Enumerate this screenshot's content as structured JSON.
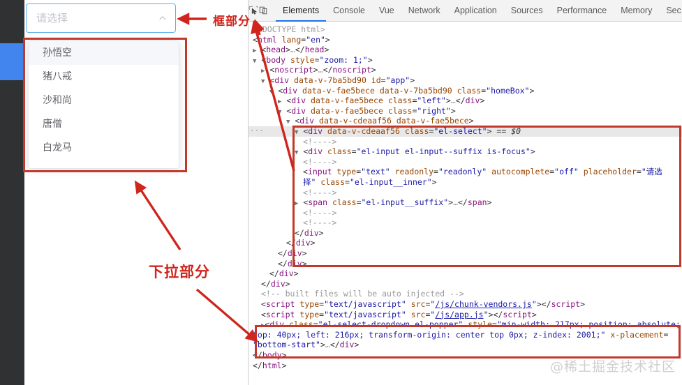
{
  "page": {
    "select": {
      "placeholder": "请选择",
      "arrow_icon": "chevron-up-icon"
    },
    "dropdown": {
      "items": [
        {
          "label": "孙悟空",
          "hovered": true
        },
        {
          "label": "猪八戒",
          "hovered": false
        },
        {
          "label": "沙和尚",
          "hovered": false
        },
        {
          "label": "唐僧",
          "hovered": false
        },
        {
          "label": "白龙马",
          "hovered": false
        }
      ]
    }
  },
  "annotations": {
    "box_label": "框部分",
    "dropdown_label": "下拉部分",
    "accent_color": "#d0251d"
  },
  "devtools": {
    "icons": [
      "inspect-element-icon",
      "device-toolbar-icon"
    ],
    "tabs": [
      {
        "label": "Elements",
        "active": true
      },
      {
        "label": "Console",
        "active": false
      },
      {
        "label": "Vue",
        "active": false
      },
      {
        "label": "Network",
        "active": false
      },
      {
        "label": "Application",
        "active": false
      },
      {
        "label": "Sources",
        "active": false
      },
      {
        "label": "Performance",
        "active": false
      },
      {
        "label": "Memory",
        "active": false
      },
      {
        "label": "Sec",
        "active": false
      }
    ],
    "code_lines": [
      {
        "indent": 0,
        "html": "<span class=\"doctype\">&lt;!DOCTYPE html&gt;</span>"
      },
      {
        "indent": 0,
        "html": "<span class=\"punc\">&lt;</span><span class=\"tag\">html</span> <span class=\"attr\">lang</span><span class=\"punc\">=</span><span class=\"val\">\"en\"</span><span class=\"punc\">&gt;</span>"
      },
      {
        "indent": 0,
        "html": "<span class=\"tri\">&#9654;</span> <span class=\"punc\">&lt;</span><span class=\"tag\">head</span><span class=\"punc\">&gt;</span><span class=\"cmt\">…</span><span class=\"punc\">&lt;/</span><span class=\"tag\">head</span><span class=\"punc\">&gt;</span>"
      },
      {
        "indent": 0,
        "html": "<span class=\"tri\">&#9660;</span> <span class=\"punc\">&lt;</span><span class=\"tag\">body</span> <span class=\"attr\">style</span><span class=\"punc\">=</span><span class=\"val\">\"zoom: 1;\"</span><span class=\"punc\">&gt;</span>"
      },
      {
        "indent": 1,
        "html": "<span class=\"tri\">&#9654;</span> <span class=\"punc\">&lt;</span><span class=\"tag\">noscript</span><span class=\"punc\">&gt;</span><span class=\"cmt\">…</span><span class=\"punc\">&lt;/</span><span class=\"tag\">noscript</span><span class=\"punc\">&gt;</span>"
      },
      {
        "indent": 1,
        "html": "<span class=\"tri\">&#9660;</span> <span class=\"punc\">&lt;</span><span class=\"tag\">div</span> <span class=\"attr\">data-v-7ba5bd90</span> <span class=\"attr\">id</span><span class=\"punc\">=</span><span class=\"val\">\"app\"</span><span class=\"punc\">&gt;</span>"
      },
      {
        "indent": 2,
        "html": "<span class=\"tri\">&#9660;</span> <span class=\"punc\">&lt;</span><span class=\"tag\">div</span> <span class=\"attr\">data-v-fae5bece</span> <span class=\"attr\">data-v-7ba5bd90</span> <span class=\"attr\">class</span><span class=\"punc\">=</span><span class=\"val\">\"homeBox\"</span><span class=\"punc\">&gt;</span>"
      },
      {
        "indent": 3,
        "html": "<span class=\"tri\">&#9654;</span> <span class=\"punc\">&lt;</span><span class=\"tag\">div</span> <span class=\"attr\">data-v-fae5bece</span> <span class=\"attr\">class</span><span class=\"punc\">=</span><span class=\"val\">\"left\"</span><span class=\"punc\">&gt;</span><span class=\"cmt\">…</span><span class=\"punc\">&lt;/</span><span class=\"tag\">div</span><span class=\"punc\">&gt;</span>"
      },
      {
        "indent": 3,
        "html": "<span class=\"tri\">&#9660;</span> <span class=\"punc\">&lt;</span><span class=\"tag\">div</span> <span class=\"attr\">data-v-fae5bece</span> <span class=\"attr\">class</span><span class=\"punc\">=</span><span class=\"val\">\"right\"</span><span class=\"punc\">&gt;</span>"
      },
      {
        "indent": 4,
        "html": "<span class=\"tri\">&#9660;</span> <span class=\"punc\">&lt;</span><span class=\"tag\">div</span> <span class=\"attr\">data-v-cdeaaf56</span> <span class=\"attr\">data-v-fae5bece</span><span class=\"punc\">&gt;</span>"
      },
      {
        "indent": 5,
        "hl": true,
        "html": "<span class=\"tri\">&#9660;</span> <span class=\"punc\">&lt;</span><span class=\"tag\">div</span> <span class=\"attr\">data-v-cdeaaf56</span> <span class=\"attr\">class</span><span class=\"punc\">=</span><span class=\"val\">\"el-select\"</span><span class=\"punc\">&gt;</span> <span class=\"dollar\">== $0</span>"
      },
      {
        "indent": 6,
        "html": "<span class=\"cmt\">&lt;!----&gt;</span>"
      },
      {
        "indent": 5,
        "html": "<span class=\"tri\">&#9660;</span> <span class=\"punc\">&lt;</span><span class=\"tag\">div</span> <span class=\"attr\">class</span><span class=\"punc\">=</span><span class=\"val\">\"el-input el-input--suffix is-focus\"</span><span class=\"punc\">&gt;</span>"
      },
      {
        "indent": 6,
        "html": "<span class=\"cmt\">&lt;!----&gt;</span>"
      },
      {
        "indent": 6,
        "html": "<span class=\"punc\">&lt;</span><span class=\"tag\">input</span> <span class=\"attr\">type</span><span class=\"punc\">=</span><span class=\"val\">\"text\"</span> <span class=\"attr\">readonly</span><span class=\"punc\">=</span><span class=\"val\">\"readonly\"</span> <span class=\"attr\">autocomplete</span><span class=\"punc\">=</span><span class=\"val\">\"off\"</span> <span class=\"attr\">placeholder</span><span class=\"punc\">=</span><span class=\"val\">\"请选</span>"
      },
      {
        "indent": 6,
        "html": "<span class=\"val\">择\"</span> <span class=\"attr\">class</span><span class=\"punc\">=</span><span class=\"val\">\"el-input__inner\"</span><span class=\"punc\">&gt;</span>"
      },
      {
        "indent": 6,
        "html": "<span class=\"cmt\">&lt;!----&gt;</span>"
      },
      {
        "indent": 5,
        "html": "<span class=\"tri\">&#9654;</span> <span class=\"punc\">&lt;</span><span class=\"tag\">span</span> <span class=\"attr\">class</span><span class=\"punc\">=</span><span class=\"val\">\"el-input__suffix\"</span><span class=\"punc\">&gt;</span><span class=\"cmt\">…</span><span class=\"punc\">&lt;/</span><span class=\"tag\">span</span><span class=\"punc\">&gt;</span>"
      },
      {
        "indent": 6,
        "html": "<span class=\"cmt\">&lt;!----&gt;</span>"
      },
      {
        "indent": 6,
        "html": "<span class=\"cmt\">&lt;!----&gt;</span>"
      },
      {
        "indent": 5,
        "html": "<span class=\"punc\">&lt;/</span><span class=\"tag\">div</span><span class=\"punc\">&gt;</span>"
      },
      {
        "indent": 4,
        "html": "<span class=\"punc\">&lt;/</span><span class=\"tag\">div</span><span class=\"punc\">&gt;</span>"
      },
      {
        "indent": 3,
        "html": "<span class=\"punc\">&lt;/</span><span class=\"tag\">div</span><span class=\"punc\">&gt;</span>"
      },
      {
        "indent": 3,
        "html": "<span class=\"punc\">&lt;/</span><span class=\"tag\">div</span><span class=\"punc\">&gt;</span>"
      },
      {
        "indent": 2,
        "html": "<span class=\"punc\">&lt;/</span><span class=\"tag\">div</span><span class=\"punc\">&gt;</span>"
      },
      {
        "indent": 1,
        "html": "<span class=\"punc\">&lt;/</span><span class=\"tag\">div</span><span class=\"punc\">&gt;</span>"
      },
      {
        "indent": 1,
        "html": "<span class=\"cmt\">&lt;!-- built files will be auto injected --&gt;</span>"
      },
      {
        "indent": 1,
        "html": "<span class=\"punc\">&lt;</span><span class=\"tag\">script</span> <span class=\"attr\">type</span><span class=\"punc\">=</span><span class=\"val\">\"text/javascript\"</span> <span class=\"attr\">src</span><span class=\"punc\">=</span><span class=\"val\">\"</span><span class=\"lnk\">/js/chunk-vendors.js</span><span class=\"val\">\"</span><span class=\"punc\">&gt;&lt;/</span><span class=\"tag\">script</span><span class=\"punc\">&gt;</span>"
      },
      {
        "indent": 1,
        "html": "<span class=\"punc\">&lt;</span><span class=\"tag\">script</span> <span class=\"attr\">type</span><span class=\"punc\">=</span><span class=\"val\">\"text/javascript\"</span> <span class=\"attr\">src</span><span class=\"punc\">=</span><span class=\"val\">\"</span><span class=\"lnk\">/js/app.js</span><span class=\"val\">\"</span><span class=\"punc\">&gt;&lt;/</span><span class=\"tag\">script</span><span class=\"punc\">&gt;</span>"
      },
      {
        "indent": 1,
        "html": "<span class=\"tri\">&#9654;</span><span class=\"punc\">&lt;</span><span class=\"tag\">div</span> <span class=\"attr\">class</span><span class=\"punc\">=</span><span class=\"val\">\"el-select-dropdown el-popper\"</span> <span class=\"attr\">style</span><span class=\"punc\">=</span><span class=\"val\">\"min-width: 217px; position: absolute;</span>"
      },
      {
        "indent": 0,
        "html": "<span class=\"val\">top: 40px; left: 216px; transform-origin: center top 0px; z-index: 2001;\"</span> <span class=\"attr\">x-placement</span><span class=\"punc\">=</span>"
      },
      {
        "indent": 0,
        "html": "<span class=\"val\">\"bottom-start\"</span><span class=\"punc\">&gt;</span><span class=\"cmt\">…</span><span class=\"punc\">&lt;/</span><span class=\"tag\">div</span><span class=\"punc\">&gt;</span>"
      },
      {
        "indent": 0,
        "html": "<span class=\"punc\">&lt;/</span><span class=\"tag\">body</span><span class=\"punc\">&gt;</span>"
      },
      {
        "indent": 0,
        "html": "<span class=\"punc\">&lt;/</span><span class=\"tag\">html</span><span class=\"punc\">&gt;</span>"
      }
    ]
  },
  "watermark": "@稀土掘金技术社区"
}
